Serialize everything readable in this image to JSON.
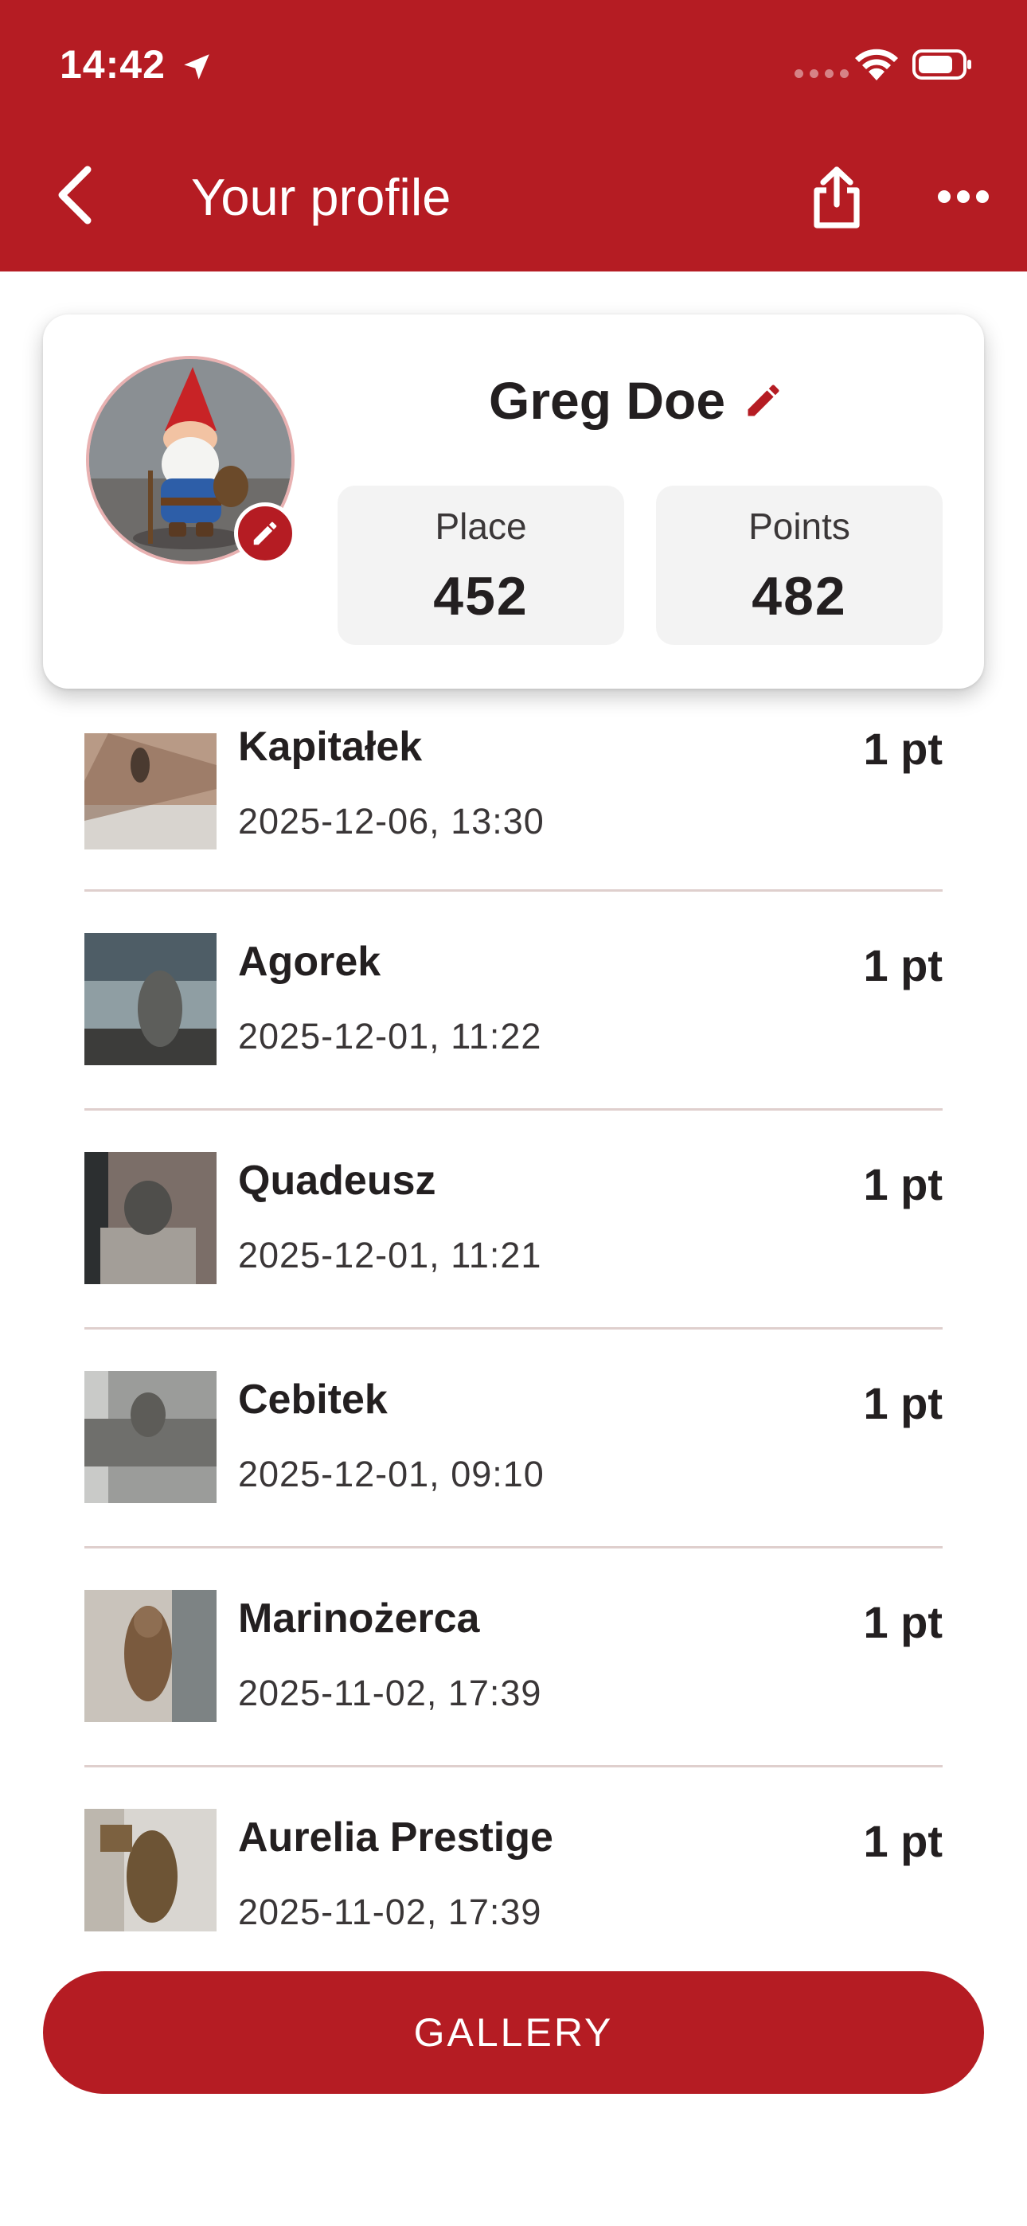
{
  "status_bar": {
    "time": "14:42",
    "icons": [
      "location-arrow-icon",
      "signal-icon",
      "wifi-icon",
      "battery-icon"
    ]
  },
  "header": {
    "title": "Your profile",
    "back_icon": "chevron-left-icon",
    "share_icon": "share-icon",
    "more_icon": "more-horizontal-icon"
  },
  "profile": {
    "name": "Greg Doe",
    "place_label": "Place",
    "place_value": "452",
    "points_label": "Points",
    "points_value": "482"
  },
  "visits": [
    {
      "name": "Kapitałek",
      "date": "2025-12-06, 13:30",
      "points": "1 pt"
    },
    {
      "name": "Agorek",
      "date": "2025-12-01, 11:22",
      "points": "1 pt"
    },
    {
      "name": "Quadeusz",
      "date": "2025-12-01, 11:21",
      "points": "1 pt"
    },
    {
      "name": "Cebitek",
      "date": "2025-12-01, 09:10",
      "points": "1 pt"
    },
    {
      "name": "Marinożerca",
      "date": "2025-11-02, 17:39",
      "points": "1 pt"
    },
    {
      "name": "Aurelia Prestige",
      "date": "2025-11-02, 17:39",
      "points": "1 pt"
    }
  ],
  "gallery_button": "GALLERY",
  "colors": {
    "brand": "#b51c23",
    "divider": "#dfcfcd",
    "stat_bg": "#f3f3f3"
  }
}
